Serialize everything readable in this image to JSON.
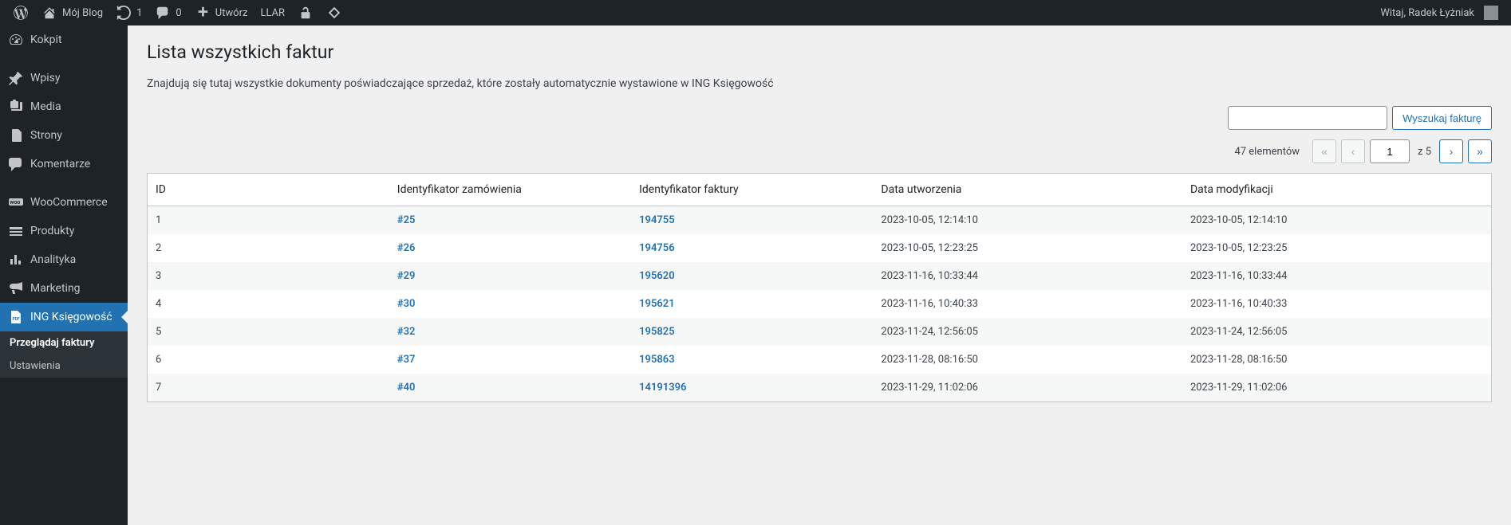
{
  "adminbar": {
    "site_name": "Mój Blog",
    "updates_count": "1",
    "comments_count": "0",
    "new_label": "Utwórz",
    "llar_label": "LLAR",
    "greeting": "Witaj, Radek Łyżniak"
  },
  "sidebar": {
    "items": [
      {
        "id": "dashboard",
        "label": "Kokpit"
      },
      {
        "id": "posts",
        "label": "Wpisy"
      },
      {
        "id": "media",
        "label": "Media"
      },
      {
        "id": "pages",
        "label": "Strony"
      },
      {
        "id": "comments",
        "label": "Komentarze"
      },
      {
        "id": "woocommerce",
        "label": "WooCommerce"
      },
      {
        "id": "products",
        "label": "Produkty"
      },
      {
        "id": "analytics",
        "label": "Analityka"
      },
      {
        "id": "marketing",
        "label": "Marketing"
      },
      {
        "id": "ing",
        "label": "ING Księgowość"
      }
    ],
    "submenu": [
      {
        "label": "Przeglądaj faktury",
        "current": true
      },
      {
        "label": "Ustawienia",
        "current": false
      }
    ]
  },
  "page": {
    "title": "Lista wszystkich faktur",
    "description": "Znajdują się tutaj wszystkie dokumenty poświadczające sprzedaż, które zostały automatycznie wystawione w ING Księgowość",
    "search_button": "Wyszukaj fakturę",
    "elements_label": "47 elementów",
    "page_current": "1",
    "page_total_label": "z 5"
  },
  "table": {
    "headers": {
      "id": "ID",
      "order": "Identyfikator zamówienia",
      "invoice": "Identyfikator faktury",
      "created": "Data utworzenia",
      "modified": "Data modyfikacji"
    },
    "rows": [
      {
        "id": "1",
        "order": "#25",
        "invoice": "194755",
        "created": "2023-10-05, 12:14:10",
        "modified": "2023-10-05, 12:14:10"
      },
      {
        "id": "2",
        "order": "#26",
        "invoice": "194756",
        "created": "2023-10-05, 12:23:25",
        "modified": "2023-10-05, 12:23:25"
      },
      {
        "id": "3",
        "order": "#29",
        "invoice": "195620",
        "created": "2023-11-16, 10:33:44",
        "modified": "2023-11-16, 10:33:44"
      },
      {
        "id": "4",
        "order": "#30",
        "invoice": "195621",
        "created": "2023-11-16, 10:40:33",
        "modified": "2023-11-16, 10:40:33"
      },
      {
        "id": "5",
        "order": "#32",
        "invoice": "195825",
        "created": "2023-11-24, 12:56:05",
        "modified": "2023-11-24, 12:56:05"
      },
      {
        "id": "6",
        "order": "#37",
        "invoice": "195863",
        "created": "2023-11-28, 08:16:50",
        "modified": "2023-11-28, 08:16:50"
      },
      {
        "id": "7",
        "order": "#40",
        "invoice": "14191396",
        "created": "2023-11-29, 11:02:06",
        "modified": "2023-11-29, 11:02:06"
      }
    ]
  }
}
